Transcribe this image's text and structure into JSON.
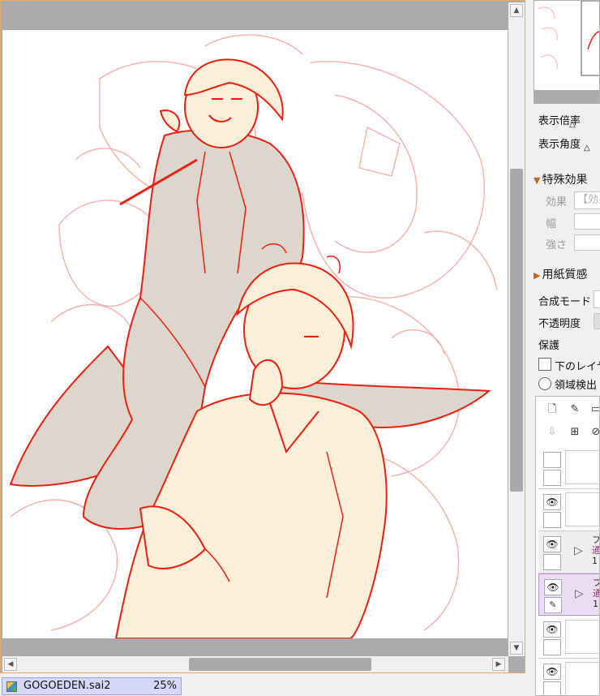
{
  "document": {
    "filename": "GOGOEDEN.sai2",
    "zoom": "25%"
  },
  "scroll": {
    "up": "▲",
    "down": "▼",
    "left": "◀",
    "right": "▶"
  },
  "navigator": {
    "zoom_label": "表示倍率",
    "angle_label": "表示角度"
  },
  "effects": {
    "section_title": "特殊効果",
    "effect_label": "効果",
    "effect_value": "【効果",
    "width_label": "幅",
    "strength_label": "強さ"
  },
  "paper": {
    "section_title": "用紙質感"
  },
  "layer_props": {
    "blend_label": "合成モード",
    "opacity_label": "不透明度",
    "protect_label": "保護",
    "clip_label": "下のレイヤ",
    "region_label": "領域検出"
  },
  "layers": [
    {
      "name": "",
      "mode": "",
      "opacity": ""
    },
    {
      "name": "",
      "mode": "",
      "opacity": ""
    },
    {
      "name": "フ",
      "mode": "通",
      "opacity": "1"
    },
    {
      "name": "フ",
      "mode": "通",
      "opacity": "1"
    },
    {
      "name": "",
      "mode": "",
      "opacity": ""
    },
    {
      "name": "",
      "mode": "",
      "opacity": ""
    }
  ],
  "colors": {
    "sketch": "#f01e10",
    "underdraw": "#f6b3ad",
    "fill_tan": "#dcd6cc",
    "fill_cream": "#fdefd8",
    "accent": "#e8a86a"
  }
}
